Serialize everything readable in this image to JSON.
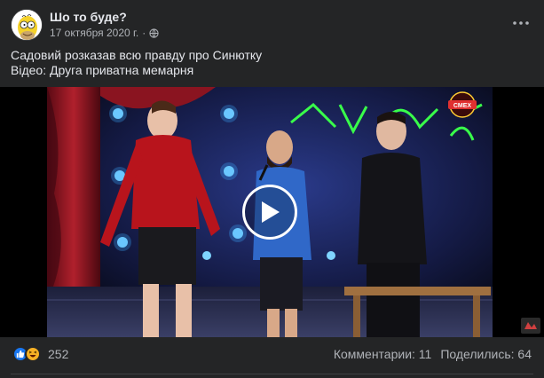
{
  "header": {
    "page_name": "Шо то буде?",
    "date": "17 октября 2020 г.",
    "separator": "·"
  },
  "post": {
    "line1": "Садовий розказав всю правду про Синютку",
    "line2": "Відео: Друга приватна мемарня"
  },
  "video": {
    "logo_text": "ЛИГА СМЕХА"
  },
  "footer": {
    "reaction_count": "252",
    "comments": "Комментарии: 11",
    "shares": "Поделились: 64"
  },
  "colors": {
    "background": "#242526",
    "text_primary": "#e4e6eb",
    "text_secondary": "#b0b3b8",
    "like_blue": "#1877f2",
    "haha_yellow": "#f7b125"
  },
  "icons": {
    "globe": "globe-icon",
    "more": "more-horizontal-icon",
    "play": "play-icon",
    "like": "like-reaction-icon",
    "haha": "haha-reaction-icon"
  }
}
